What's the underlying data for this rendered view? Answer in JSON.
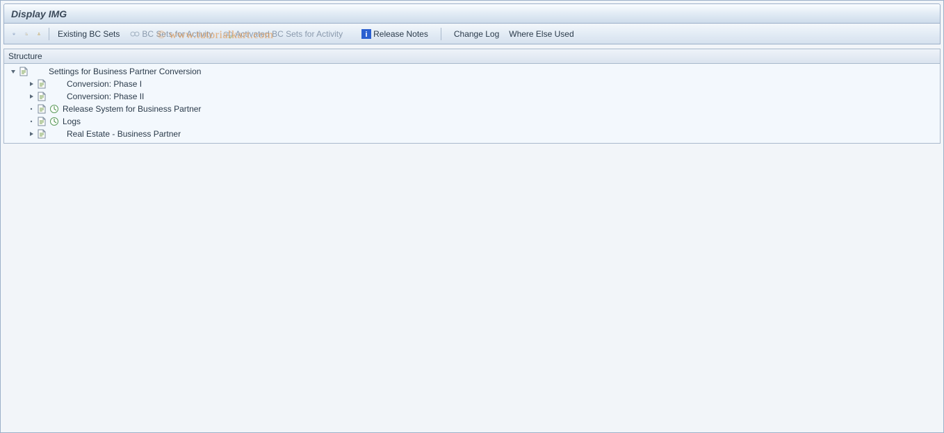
{
  "window": {
    "title": "Display IMG"
  },
  "toolbar": {
    "existing_bc_sets": "Existing BC Sets",
    "bc_sets_for_activity": "BC Sets for Activity",
    "activated_bc_sets_for_activity": "Activated BC Sets for Activity",
    "release_notes": "Release Notes",
    "change_log": "Change Log",
    "where_else_used": "Where Else Used"
  },
  "panel": {
    "header": "Structure"
  },
  "tree": {
    "root": {
      "label": "Settings for Business Partner Conversion",
      "expanded": true
    },
    "children": [
      {
        "label": "Conversion: Phase I",
        "expandable": true,
        "executable": false
      },
      {
        "label": "Conversion: Phase II",
        "expandable": true,
        "executable": false
      },
      {
        "label": "Release System for Business Partner",
        "expandable": false,
        "executable": true
      },
      {
        "label": "Logs",
        "expandable": false,
        "executable": true
      },
      {
        "label": "Real Estate - Business Partner",
        "expandable": true,
        "executable": false
      }
    ]
  },
  "watermark": "© www.tutorialkart.com"
}
